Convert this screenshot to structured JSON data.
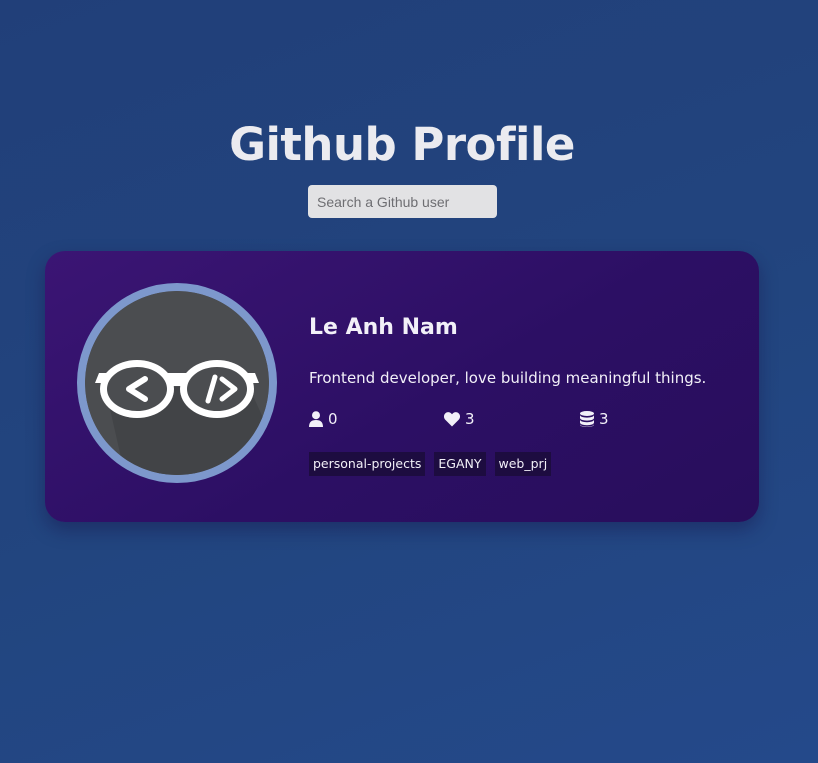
{
  "header": {
    "title": "Github Profile"
  },
  "search": {
    "placeholder": "Search a Github user",
    "value": ""
  },
  "profile": {
    "name": "Le Anh Nam",
    "bio": "Frontend developer, love building meaningful things.",
    "avatar_icon": "glasses-code-icon",
    "stats": {
      "followers": "0",
      "following": "3",
      "repos": "3"
    },
    "stat_icons": {
      "followers": "user-icon",
      "following": "heart-icon",
      "repos": "database-icon"
    },
    "repositories": [
      "personal-projects",
      "EGANY",
      "web_prj"
    ]
  },
  "colors": {
    "background": "#22457f",
    "card": "#2c0f64",
    "avatar_ring": "#7d98cc",
    "repo_tag": "#1d0c40",
    "search_field": "#e2e2e4"
  }
}
